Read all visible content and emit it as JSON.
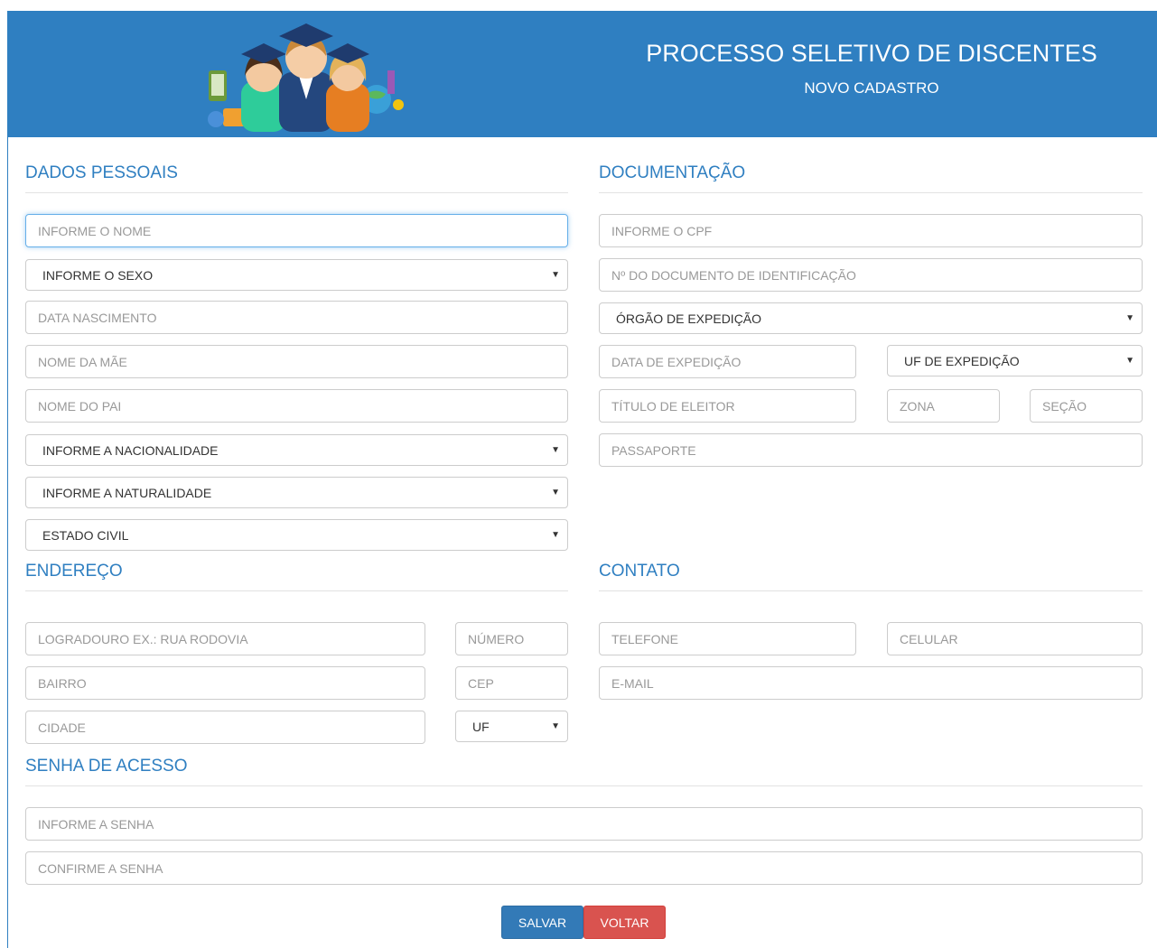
{
  "header": {
    "title": "PROCESSO SELETIVO DE DISCENTES",
    "subtitle": "NOVO CADASTRO",
    "logo_icon": "students-graduation-logo-icon"
  },
  "colors": {
    "primary": "#2f7fc1",
    "save": "#337ab7",
    "back": "#d9534f"
  },
  "pessoais": {
    "title": "DADOS PESSOAIS",
    "nome_placeholder": "INFORME O NOME",
    "sexo_selected": "INFORME O SEXO",
    "nascimento_placeholder": "DATA NASCIMENTO",
    "mae_placeholder": "NOME DA MÃE",
    "pai_placeholder": "NOME DO PAI",
    "nacionalidade_selected": "INFORME A NACIONALIDADE",
    "naturalidade_selected": "INFORME A NATURALIDADE",
    "estado_civil_selected": "ESTADO CIVIL"
  },
  "documentacao": {
    "title": "DOCUMENTAÇÃO",
    "cpf_placeholder": "INFORME O CPF",
    "doc_placeholder": "Nº DO DOCUMENTO DE IDENTIFICAÇÃO",
    "orgao_selected": "ÓRGÃO DE EXPEDIÇÃO",
    "data_exp_placeholder": "DATA DE EXPEDIÇÃO",
    "uf_exp_selected": "UF DE EXPEDIÇÃO",
    "titulo_placeholder": "TÍTULO DE ELEITOR",
    "zona_placeholder": "ZONA",
    "secao_placeholder": "SEÇÃO",
    "passaporte_placeholder": "PASSAPORTE"
  },
  "endereco": {
    "title": "ENDEREÇO",
    "logradouro_placeholder": "LOGRADOURO EX.: RUA RODOVIA",
    "numero_placeholder": "NÚMERO",
    "bairro_placeholder": "BAIRRO",
    "cep_placeholder": "CEP",
    "cidade_placeholder": "CIDADE",
    "uf_selected": "UF"
  },
  "contato": {
    "title": "CONTATO",
    "telefone_placeholder": "TELEFONE",
    "celular_placeholder": "CELULAR",
    "email_placeholder": "E-MAIL"
  },
  "senha": {
    "title": "SENHA DE ACESSO",
    "senha_placeholder": "INFORME A SENHA",
    "confirma_placeholder": "CONFIRME A SENHA"
  },
  "actions": {
    "save_label": "SALVAR",
    "back_label": "VOLTAR"
  }
}
